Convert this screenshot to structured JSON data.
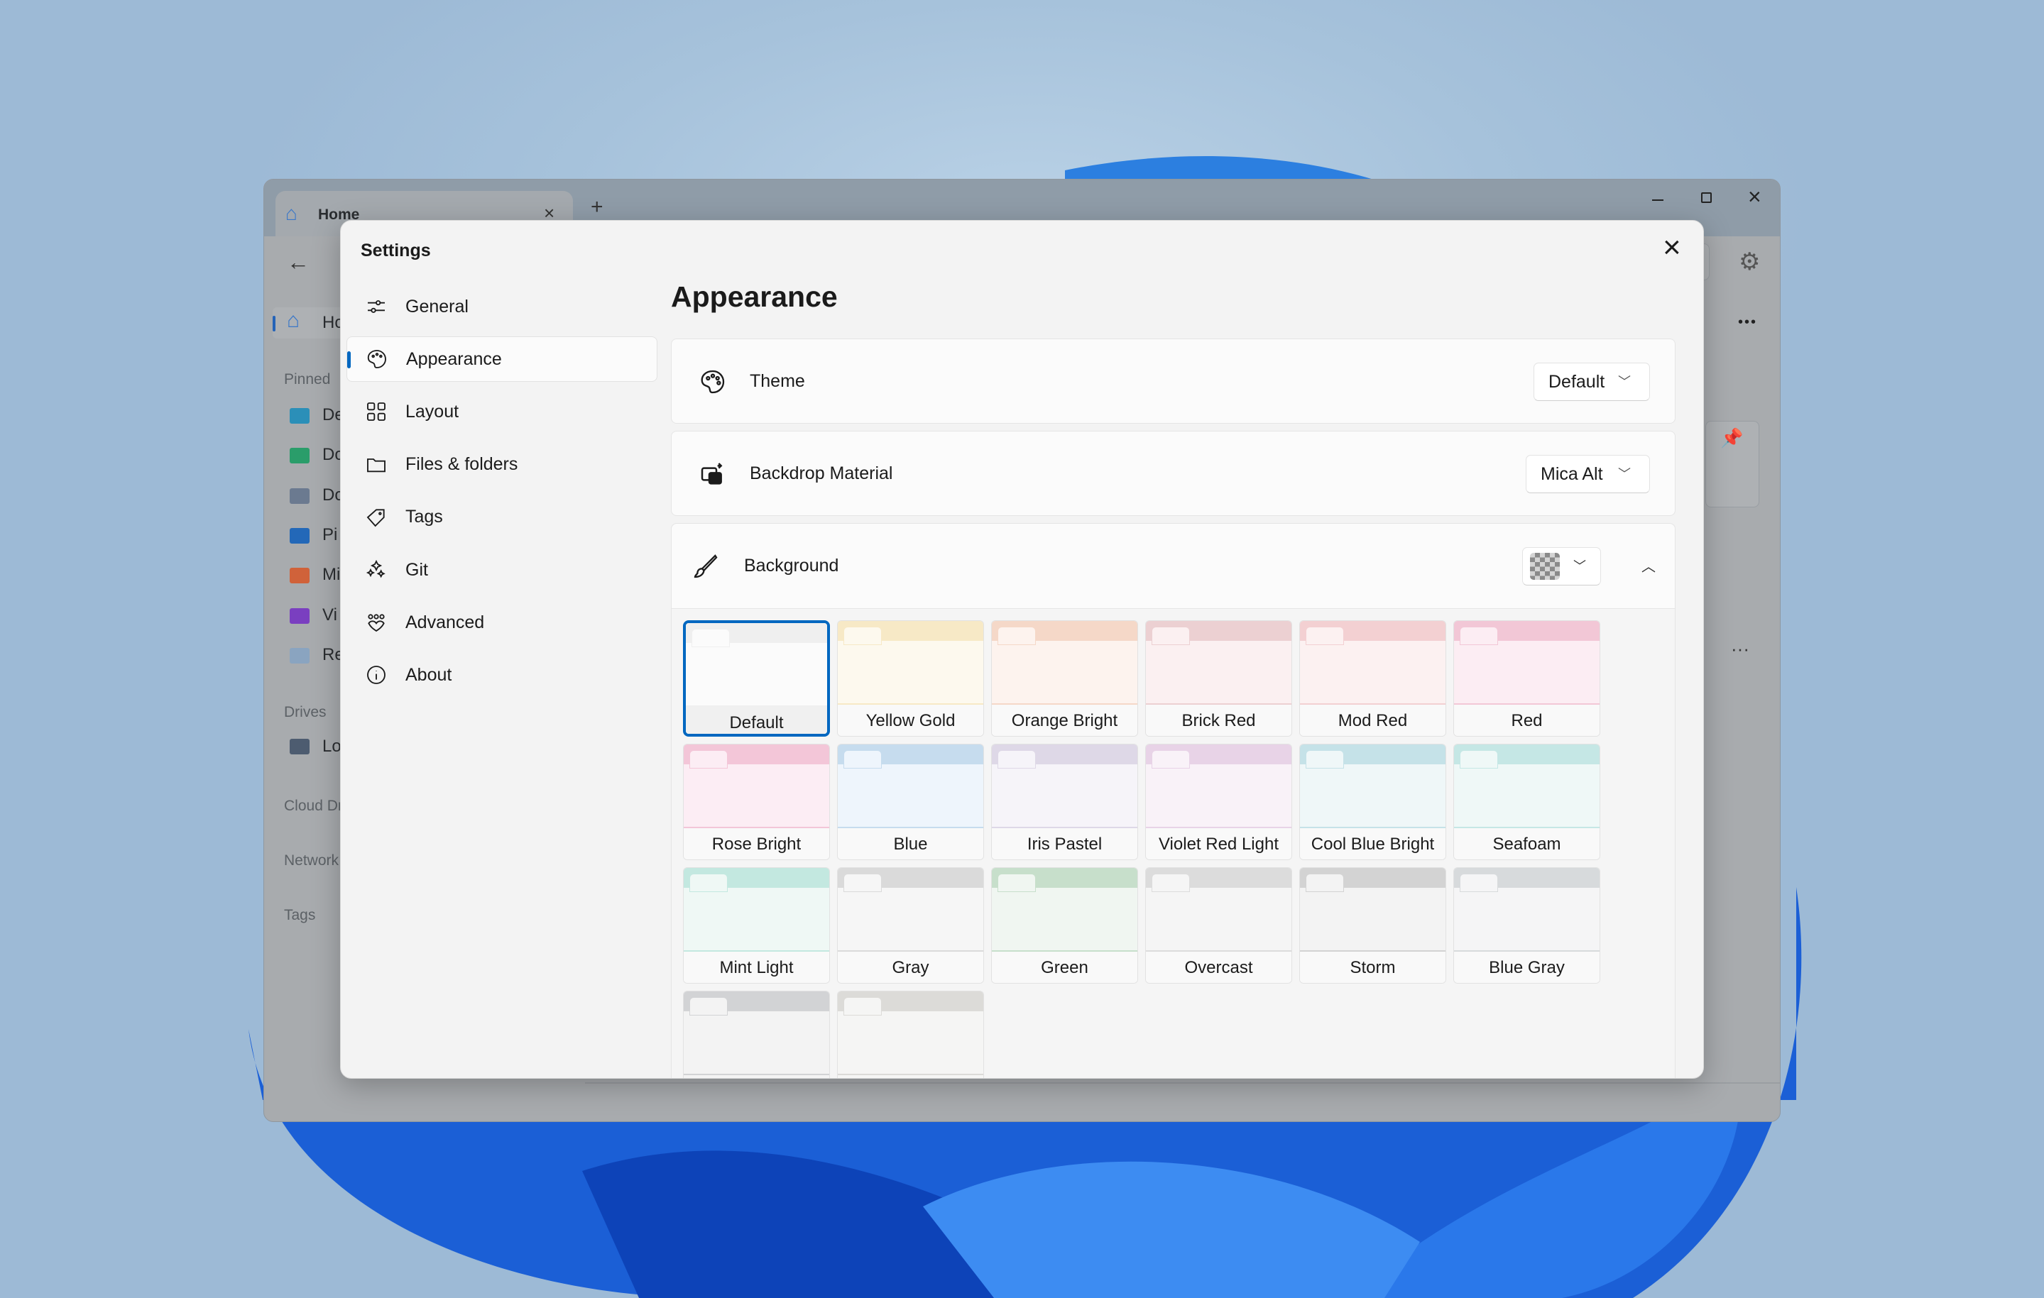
{
  "explorer": {
    "tab_title": "Home",
    "sidebar_home": "Ho",
    "pinned_label": "Pinned",
    "pinned_items": [
      "De",
      "Do",
      "Do",
      "Pi",
      "Mi",
      "Vi",
      "Re"
    ],
    "drives_label": "Drives",
    "drive_items": [
      "Lo"
    ],
    "cloud_label": "Cloud Dr",
    "network_label": "Network",
    "tags_label": "Tags",
    "more": "•••",
    "more_small": "···"
  },
  "settings": {
    "title": "Settings",
    "nav": [
      {
        "label": "General",
        "icon": "sliders-icon"
      },
      {
        "label": "Appearance",
        "icon": "palette-icon",
        "selected": true
      },
      {
        "label": "Layout",
        "icon": "grid-icon"
      },
      {
        "label": "Files & folders",
        "icon": "folder-icon"
      },
      {
        "label": "Tags",
        "icon": "tag-icon"
      },
      {
        "label": "Git",
        "icon": "sparkle-icon"
      },
      {
        "label": "Advanced",
        "icon": "people-icon"
      },
      {
        "label": "About",
        "icon": "info-icon"
      }
    ],
    "page_title": "Appearance",
    "theme": {
      "label": "Theme",
      "value": "Default"
    },
    "backdrop": {
      "label": "Backdrop Material",
      "value": "Mica Alt"
    },
    "background": {
      "label": "Background"
    },
    "accent": "#0067c0",
    "tiles": [
      {
        "label": "Default",
        "header": "#efefef",
        "body": "#fbfbfb",
        "selected": true
      },
      {
        "label": "Yellow Gold",
        "header": "#f7e9c6",
        "body": "#fdf9ee"
      },
      {
        "label": "Orange Bright",
        "header": "#f5d8c8",
        "body": "#fdf3ee"
      },
      {
        "label": "Brick Red",
        "header": "#ecd0d2",
        "body": "#fbf0f1"
      },
      {
        "label": "Mod Red",
        "header": "#f3d0d2",
        "body": "#fcf1f1"
      },
      {
        "label": "Red",
        "header": "#f2c7d6",
        "body": "#fcedf3"
      },
      {
        "label": "Rose Bright",
        "header": "#f3c6d8",
        "body": "#fcedf4"
      },
      {
        "label": "Blue",
        "header": "#c6dcee",
        "body": "#eef5fc"
      },
      {
        "label": "Iris Pastel",
        "header": "#ded8e7",
        "body": "#f6f4f9"
      },
      {
        "label": "Violet Red Light",
        "header": "#e8d3e7",
        "body": "#f9f2f8"
      },
      {
        "label": "Cool Blue Bright",
        "header": "#c5e2e8",
        "body": "#eff7f8"
      },
      {
        "label": "Seafoam",
        "header": "#c5e7e5",
        "body": "#eff8f7"
      },
      {
        "label": "Mint Light",
        "header": "#c3e8e0",
        "body": "#eff8f5"
      },
      {
        "label": "Gray",
        "header": "#dadada",
        "body": "#f6f6f6"
      },
      {
        "label": "Green",
        "header": "#c7dfcb",
        "body": "#f0f6f1"
      },
      {
        "label": "Overcast",
        "header": "#dcdcdc",
        "body": "#f5f5f5"
      },
      {
        "label": "Storm",
        "header": "#d3d3d3",
        "body": "#f3f3f3"
      },
      {
        "label": "Blue Gray",
        "header": "#d7dadc",
        "body": "#f5f5f6"
      },
      {
        "label": "",
        "header": "#d2d3d5",
        "body": "#f3f3f3"
      },
      {
        "label": "",
        "header": "#dcdbd8",
        "body": "#f5f5f4"
      }
    ]
  }
}
